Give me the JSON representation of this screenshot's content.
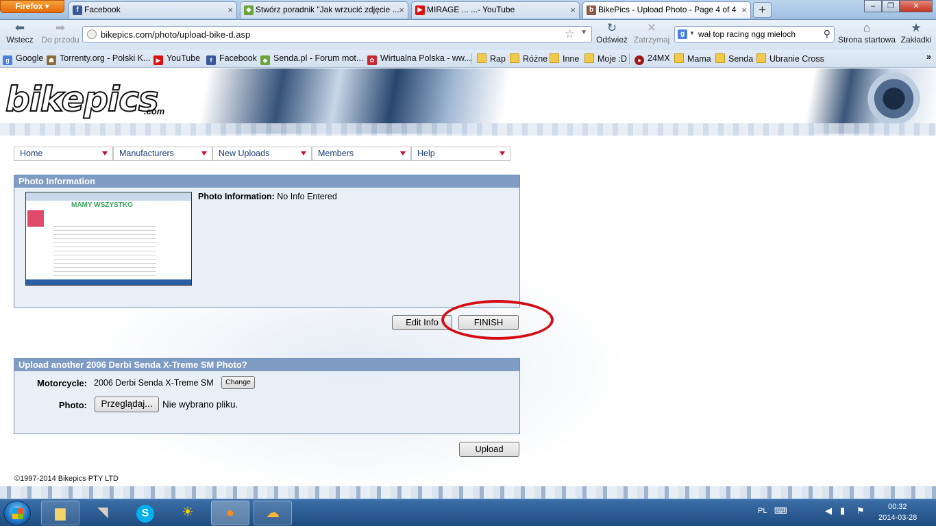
{
  "browser": {
    "firefox_label": "Firefox",
    "tabs": [
      {
        "label": "Facebook",
        "icon": "facebook-icon"
      },
      {
        "label": "Stwórz poradnik \"Jak wrzucić zdjęcie ...",
        "icon": "senda-icon"
      },
      {
        "label": "MIRAGE ... ...- YouTube",
        "icon": "youtube-icon"
      },
      {
        "label": "BikePics - Upload Photo - Page 4 of 4",
        "icon": "bikepics-icon"
      }
    ],
    "nav": {
      "back": "Wstecz",
      "forward": "Do przodu",
      "refresh": "Odśwież",
      "stop": "Zatrzymaj",
      "home": "Strona startowa",
      "bookmarks": "Zakładki"
    },
    "url": "bikepics.com/photo/upload-bike-d.asp",
    "search_value": "wał top racing ngg mieloch",
    "bookmarks": [
      {
        "label": "Google",
        "type": "google-icon"
      },
      {
        "label": "Torrenty.org - Polski K...",
        "type": "torrent-icon"
      },
      {
        "label": "YouTube",
        "type": "youtube-icon"
      },
      {
        "label": "Facebook",
        "type": "facebook-icon"
      },
      {
        "label": "Senda.pl - Forum mot...",
        "type": "senda-icon"
      },
      {
        "label": "Wirtualna Polska - ww...",
        "type": "wp-icon"
      },
      {
        "label": "Rap",
        "type": "folder-icon"
      },
      {
        "label": "Różne",
        "type": "folder-icon"
      },
      {
        "label": "Inne",
        "type": "folder-icon"
      },
      {
        "label": "Moje :D",
        "type": "folder-icon"
      },
      {
        "label": "24MX",
        "type": "mx-icon"
      },
      {
        "label": "Mama",
        "type": "folder-icon"
      },
      {
        "label": "Senda",
        "type": "folder-icon"
      },
      {
        "label": "Ubranie Cross",
        "type": "folder-icon"
      }
    ],
    "bookmarks_overflow": "»"
  },
  "site": {
    "logo": "bikepics",
    "logo_suffix": ".com",
    "menu": [
      "Home",
      "Manufacturers",
      "New Uploads",
      "Members",
      "Help"
    ],
    "photo_panel": {
      "title": "Photo Information",
      "info_label": "Photo Information:",
      "info_value": "No Info Entered",
      "thumb_heading": "MAMY WSZYSTKO"
    },
    "edit_button": "Edit Info",
    "finish_button": "FINISH",
    "upload_panel": {
      "title": "Upload another 2006 Derbi Senda X-Treme SM Photo?",
      "motorcycle_label": "Motorcycle:",
      "motorcycle_value": "2006 Derbi Senda X-Treme SM",
      "change_button": "Change",
      "photo_label": "Photo:",
      "browse_button": "Przeglądaj...",
      "no_file": "Nie wybrano pliku."
    },
    "upload_button": "Upload",
    "copyright": "©1997-2014 Bikepics PTY LTD"
  },
  "taskbar": {
    "lang": "PL",
    "time": "00:32",
    "date": "2014-03-28"
  },
  "colors": {
    "accent_ring": "#d40d14",
    "panel_header": "#7e9cc4",
    "menu_arrow": "#c8102e"
  }
}
